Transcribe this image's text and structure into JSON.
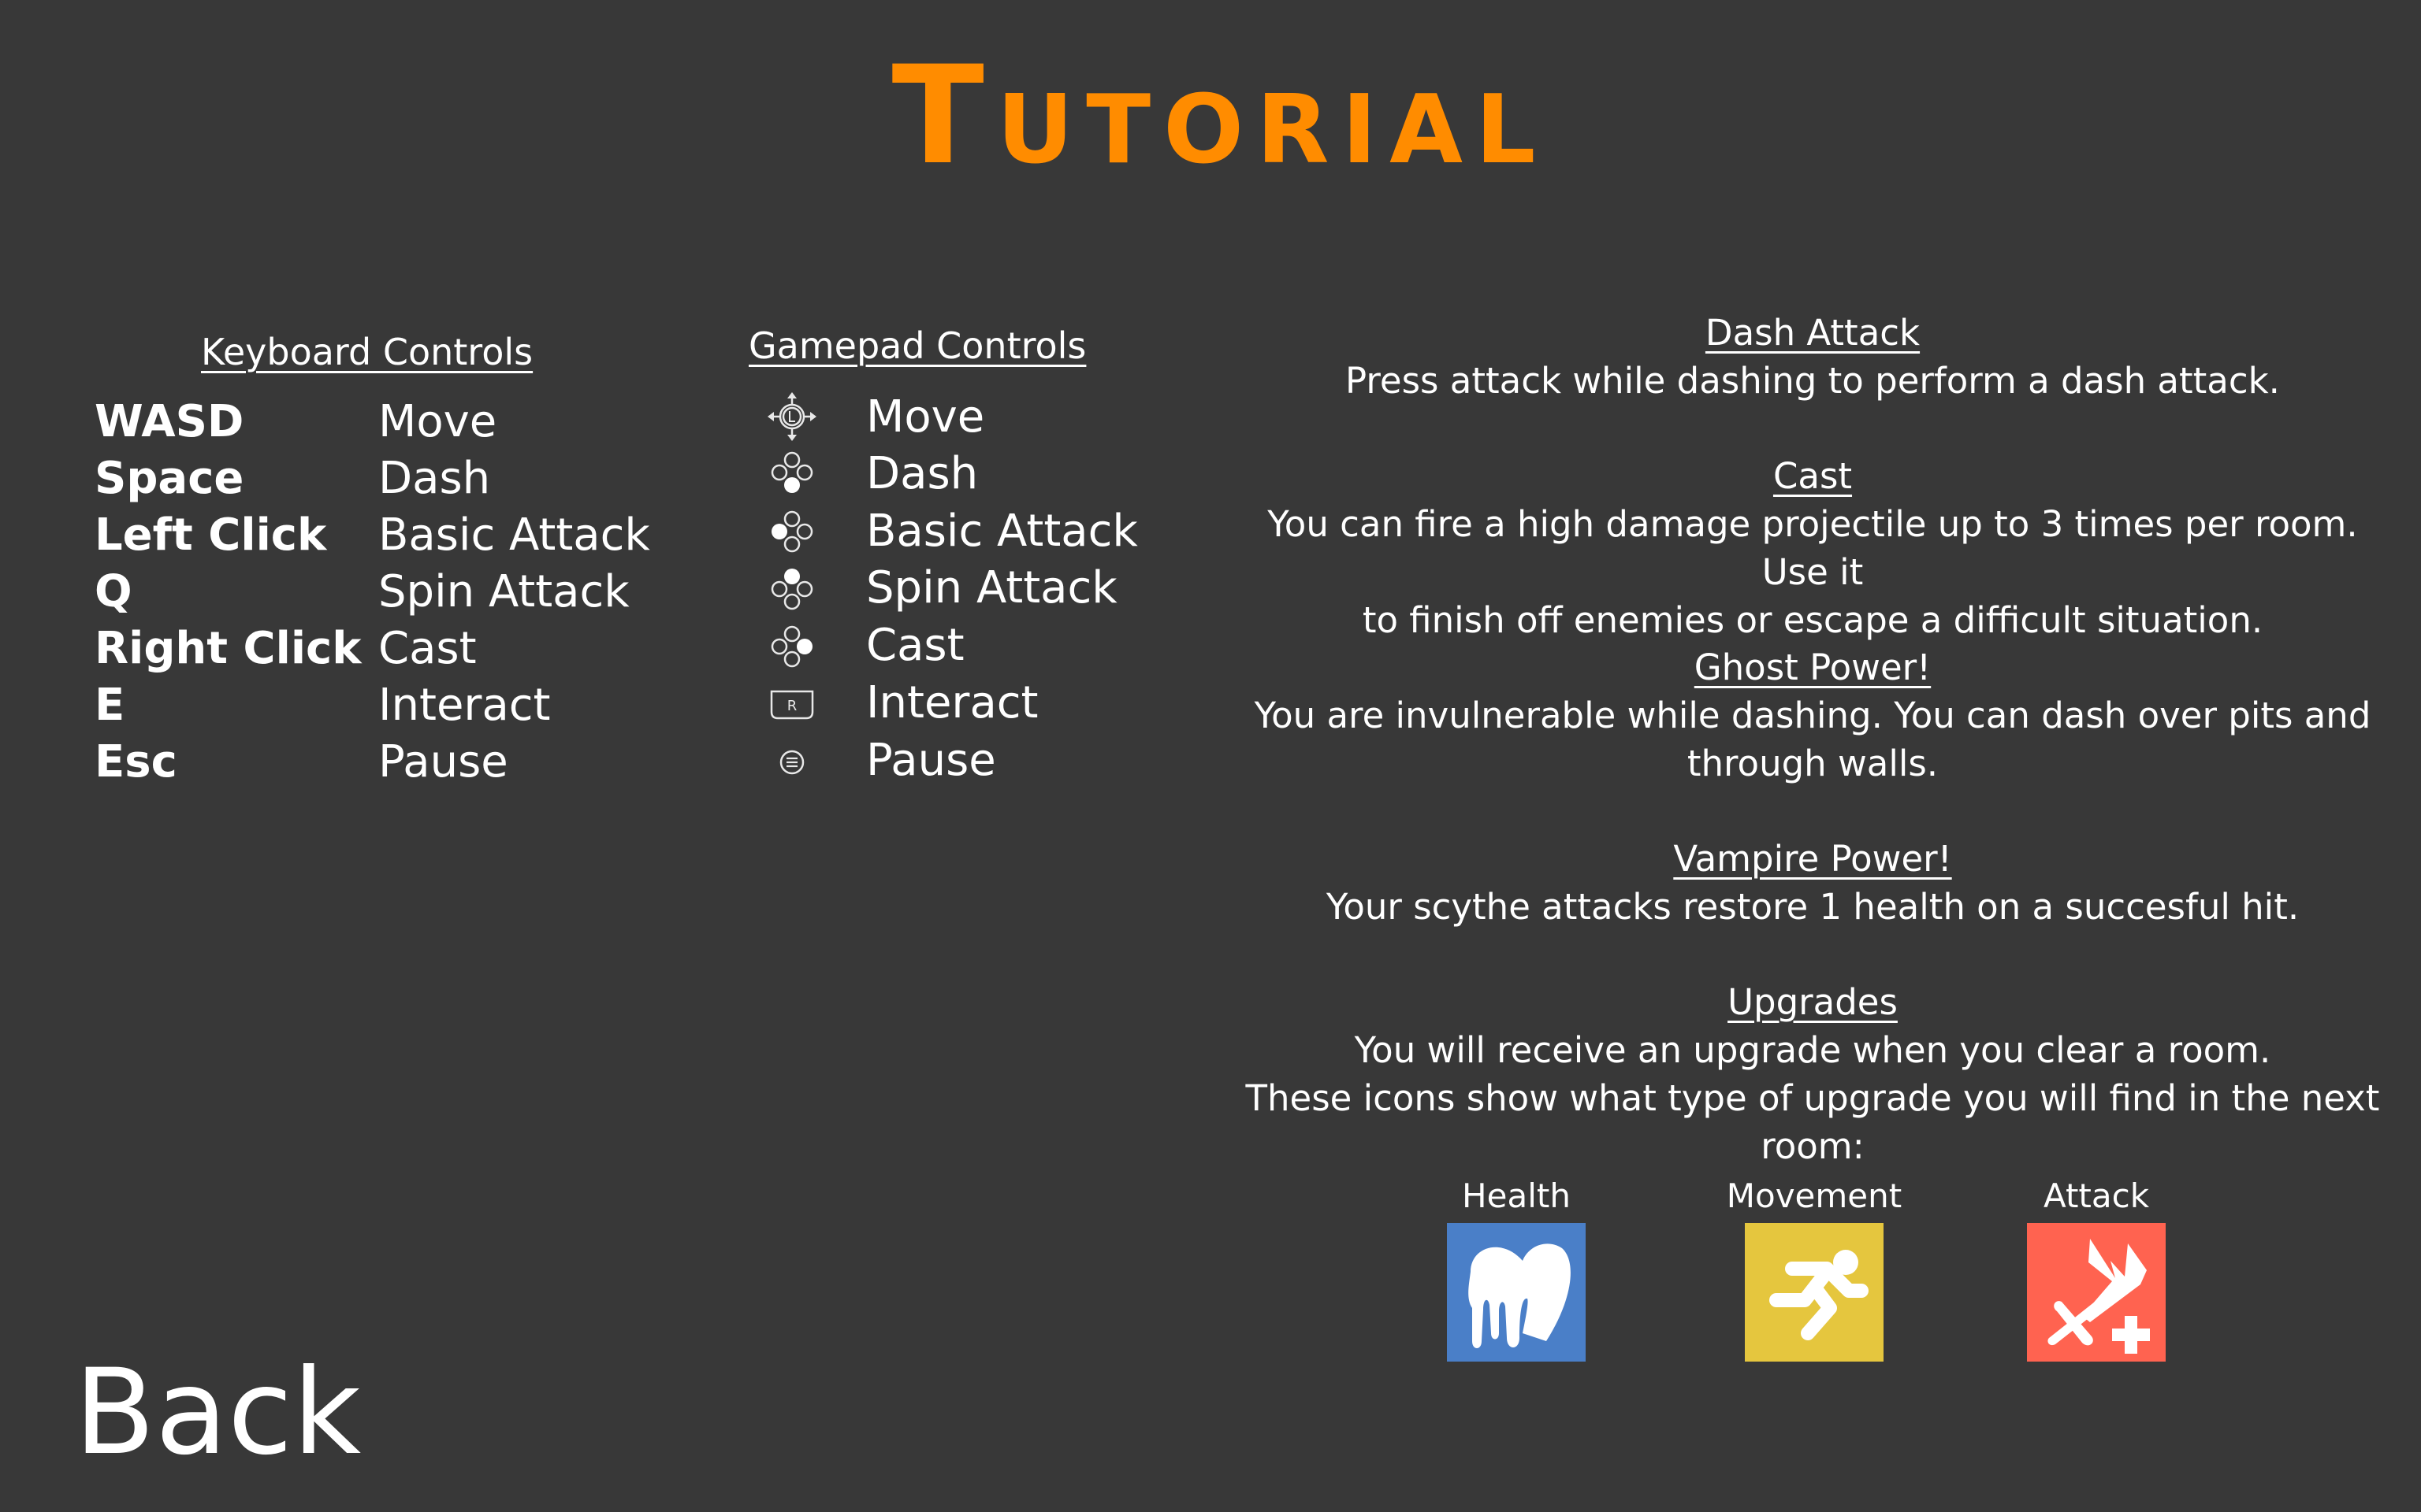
{
  "title": "Tutorial",
  "keyboard": {
    "header": "Keyboard Controls",
    "rows": [
      {
        "key": "WASD",
        "action": "Move"
      },
      {
        "key": "Space",
        "action": "Dash"
      },
      {
        "key": "Left Click",
        "action": "Basic Attack"
      },
      {
        "key": "Q",
        "action": "Spin Attack"
      },
      {
        "key": "Right Click",
        "action": "Cast"
      },
      {
        "key": "E",
        "action": "Interact"
      },
      {
        "key": "Esc",
        "action": "Pause"
      }
    ]
  },
  "gamepad": {
    "header": "Gamepad Controls",
    "rows": [
      {
        "icon": "left-stick-icon",
        "action": "Move"
      },
      {
        "icon": "face-button-bottom-icon",
        "action": "Dash"
      },
      {
        "icon": "face-button-left-icon",
        "action": "Basic Attack"
      },
      {
        "icon": "face-button-top-icon",
        "action": "Spin Attack"
      },
      {
        "icon": "face-button-right-icon",
        "action": "Cast"
      },
      {
        "icon": "r-bumper-icon",
        "action": "Interact"
      },
      {
        "icon": "menu-button-icon",
        "action": "Pause"
      }
    ]
  },
  "tips": [
    {
      "heading": "Dash Attack",
      "lines": [
        "Press attack while dashing to perform a dash attack."
      ]
    },
    {
      "heading": "Cast",
      "lines": [
        "You can fire a high damage projectile up to 3 times per room. Use it",
        "to finish off enemies or escape a difficult situation."
      ]
    },
    {
      "heading": "Ghost Power!",
      "lines": [
        "You are invulnerable while dashing. You can dash over pits and",
        "through walls."
      ]
    },
    {
      "heading": "Vampire Power!",
      "lines": [
        "Your scythe attacks restore 1 health on a succesful hit."
      ]
    },
    {
      "heading": "Upgrades",
      "lines": [
        "You will receive an upgrade when you clear a room.",
        "These icons show what type of upgrade you will find in the next room:"
      ]
    }
  ],
  "upgrades": [
    {
      "label": "Health",
      "icon": "melting-heart-icon",
      "color": "#4a7fc8"
    },
    {
      "label": "Movement",
      "icon": "running-person-icon",
      "color": "#e5c63e"
    },
    {
      "label": "Attack",
      "icon": "sword-plus-icon",
      "color": "#ff6350"
    }
  ],
  "back_label": "Back",
  "colors": {
    "background": "#383838",
    "title": "#ff8c00",
    "text": "#ffffff"
  }
}
